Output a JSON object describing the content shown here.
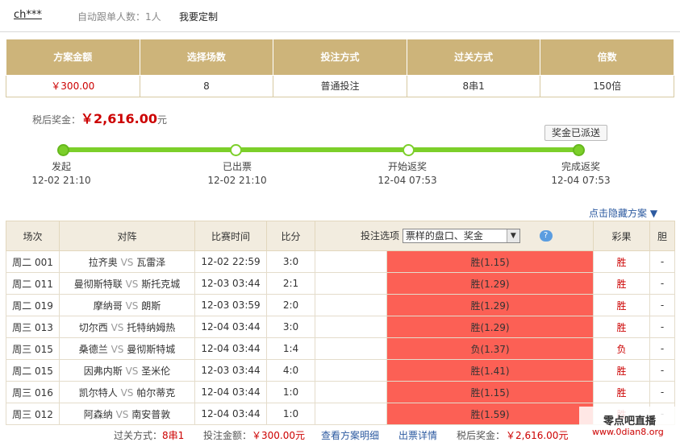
{
  "header": {
    "user": "ch***",
    "auto_follow_label": "自动跟单人数：",
    "auto_follow_count": "1人",
    "custom_link": "我要定制"
  },
  "summary": {
    "headers": [
      "方案金额",
      "选择场数",
      "投注方式",
      "过关方式",
      "倍数"
    ],
    "values": [
      "￥300.00",
      "8",
      "普通投注",
      "8串1",
      "150倍"
    ]
  },
  "prize": {
    "label": "税后奖金：",
    "amount": "￥2,616.00",
    "unit": "元",
    "sent_button": "奖金已派送"
  },
  "progress": {
    "steps": [
      {
        "label": "发起",
        "time": "12-02 21:10"
      },
      {
        "label": "已出票",
        "time": "12-02 21:10"
      },
      {
        "label": "开始返奖",
        "time": "12-04 07:53"
      },
      {
        "label": "完成返奖",
        "time": "12-04 07:53"
      }
    ]
  },
  "hide_link": "点击隐藏方案 ▼",
  "matches": {
    "headers": [
      "场次",
      "对阵",
      "比赛时间",
      "比分",
      "投注选项",
      "彩果",
      "胆"
    ],
    "option_select": "票样的盘口、奖金",
    "help": "?",
    "vs": "VS",
    "rows": [
      {
        "no": "周二 001",
        "home": "拉齐奥",
        "away": "瓦雷泽",
        "time": "12-02 22:59",
        "score": "3:0",
        "pick": "胜(1.15)",
        "result": "胜",
        "banker": "-"
      },
      {
        "no": "周二 011",
        "home": "曼彻斯特联",
        "away": "斯托克城",
        "time": "12-03 03:44",
        "score": "2:1",
        "pick": "胜(1.29)",
        "result": "胜",
        "banker": "-"
      },
      {
        "no": "周二 019",
        "home": "摩纳哥",
        "away": "朗斯",
        "time": "12-03 03:59",
        "score": "2:0",
        "pick": "胜(1.29)",
        "result": "胜",
        "banker": "-"
      },
      {
        "no": "周三 013",
        "home": "切尔西",
        "away": "托特纳姆热",
        "time": "12-04 03:44",
        "score": "3:0",
        "pick": "胜(1.29)",
        "result": "胜",
        "banker": "-"
      },
      {
        "no": "周三 015",
        "home": "桑德兰",
        "away": "曼彻斯特城",
        "time": "12-04 03:44",
        "score": "1:4",
        "pick": "负(1.37)",
        "result": "负",
        "banker": "-"
      },
      {
        "no": "周二 015",
        "home": "因弗内斯",
        "away": "圣米伦",
        "time": "12-03 03:44",
        "score": "4:0",
        "pick": "胜(1.41)",
        "result": "胜",
        "banker": "-"
      },
      {
        "no": "周三 016",
        "home": "凯尔特人",
        "away": "帕尔蒂克",
        "time": "12-04 03:44",
        "score": "1:0",
        "pick": "胜(1.15)",
        "result": "胜",
        "banker": "-"
      },
      {
        "no": "周三 012",
        "home": "阿森纳",
        "away": "南安普敦",
        "time": "12-04 03:44",
        "score": "1:0",
        "pick": "胜(1.59)",
        "result": "胜",
        "banker": "-"
      }
    ]
  },
  "footer": {
    "pass_label": "过关方式：",
    "pass_value": "8串1",
    "bet_label": "投注金额：",
    "bet_value": "￥300.00元",
    "detail_link": "查看方案明细",
    "ticket_link": "出票详情",
    "prize_label": "税后奖金：",
    "prize_value": "￥2,616.00元"
  },
  "watermark": {
    "line1": "零点吧直播",
    "line2": "www.0dian8.org"
  }
}
